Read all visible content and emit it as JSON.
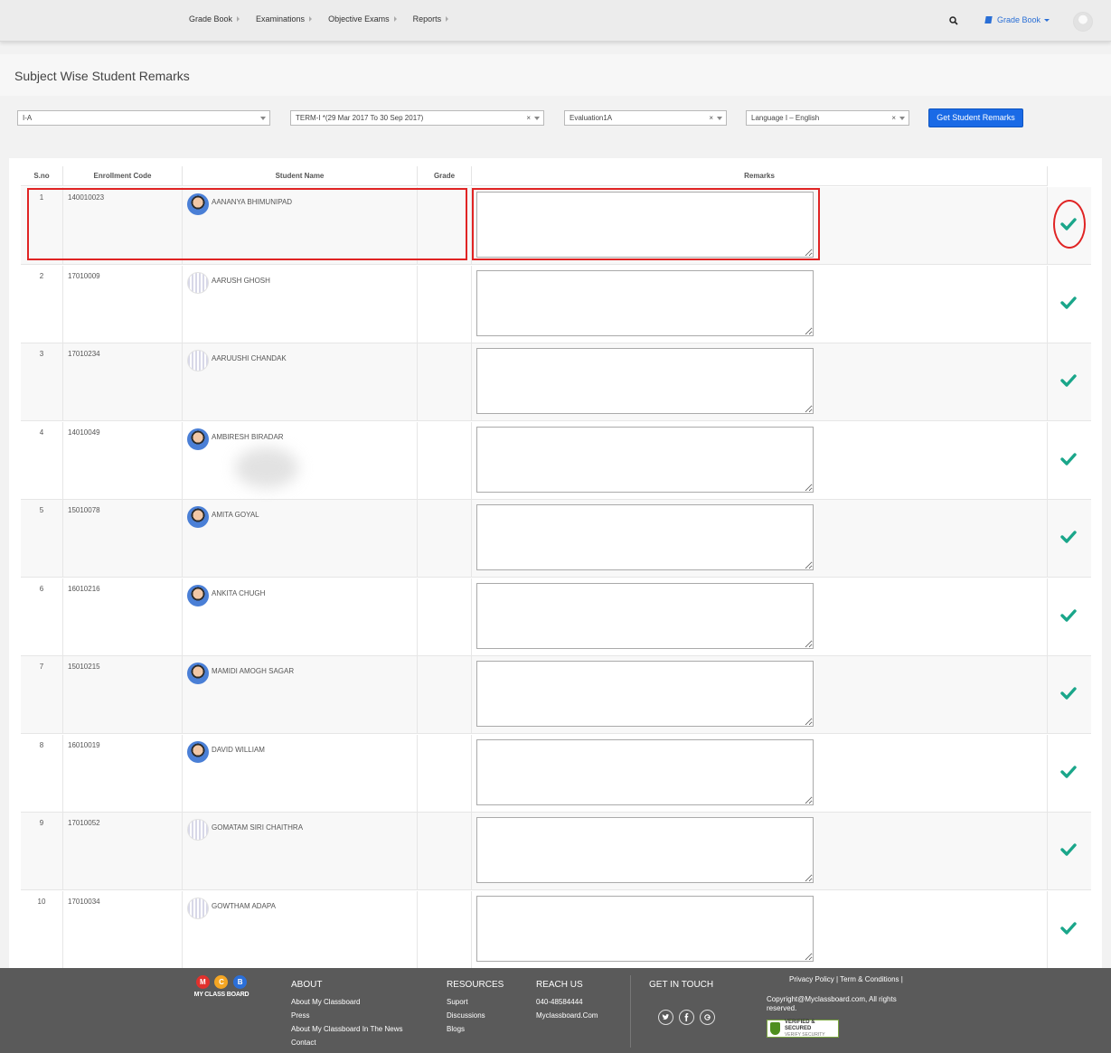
{
  "nav": {
    "menu": [
      "Grade Book",
      "Examinations",
      "Objective Exams",
      "Reports"
    ],
    "right_menu": "Grade Book"
  },
  "page_title": "Subject Wise Student Remarks",
  "filters": {
    "class": "I-A",
    "term": "TERM-I *(29 Mar 2017 To 30 Sep 2017)",
    "evaluation": "Evaluation1A",
    "subject": "Language I – English",
    "clear_glyph": "×"
  },
  "get_button": "Get Student Remarks",
  "table": {
    "headers": [
      "S.no",
      "Enrollment Code",
      "Student Name",
      "Grade",
      "Remarks"
    ],
    "rows": [
      {
        "sno": "1",
        "code": "140010023",
        "name": "AANANYA BHIMUNIPAD",
        "photo": true
      },
      {
        "sno": "2",
        "code": "17010009",
        "name": "AARUSH GHOSH",
        "photo": false
      },
      {
        "sno": "3",
        "code": "17010234",
        "name": "AARUUSHI CHANDAK",
        "photo": false
      },
      {
        "sno": "4",
        "code": "14010049",
        "name": "AMBIRESH BIRADAR",
        "photo": true
      },
      {
        "sno": "5",
        "code": "15010078",
        "name": "AMITA GOYAL",
        "photo": true
      },
      {
        "sno": "6",
        "code": "16010216",
        "name": "ANKITA CHUGH",
        "photo": true
      },
      {
        "sno": "7",
        "code": "15010215",
        "name": "MAMIDI AMOGH SAGAR",
        "photo": true
      },
      {
        "sno": "8",
        "code": "16010019",
        "name": "DAVID WILLIAM",
        "photo": true
      },
      {
        "sno": "9",
        "code": "17010052",
        "name": "GOMATAM SIRI CHAITHRA",
        "photo": false
      },
      {
        "sno": "10",
        "code": "17010034",
        "name": "GOWTHAM ADAPA",
        "photo": false
      }
    ]
  },
  "colors": {
    "accent": "#1a6ae6",
    "check": "#1aa68a",
    "highlight": "#e02424",
    "footer": "#5a5a5a"
  },
  "footer": {
    "logo_letters": [
      "M",
      "C",
      "B"
    ],
    "logo_text": "MY CLASS BOARD",
    "about": {
      "title": "ABOUT",
      "links": [
        "About My Classboard",
        "Press",
        "About My Classboard In The News",
        "Contact"
      ]
    },
    "resources": {
      "title": "RESOURCES",
      "links": [
        "Suport",
        "Discussions",
        "Blogs"
      ]
    },
    "reach": {
      "title": "REACH US",
      "links": [
        "040-48584444",
        "Myclassboard.Com"
      ]
    },
    "touch": {
      "title": "GET IN TOUCH"
    },
    "legal": "Privacy Policy | Term & Conditions |",
    "copyright": "Copyright@Myclassboard.com, All rights reserved.",
    "verified": "VERIFIED & SECURED",
    "verified_sub": "VERIFY SECURITY"
  }
}
